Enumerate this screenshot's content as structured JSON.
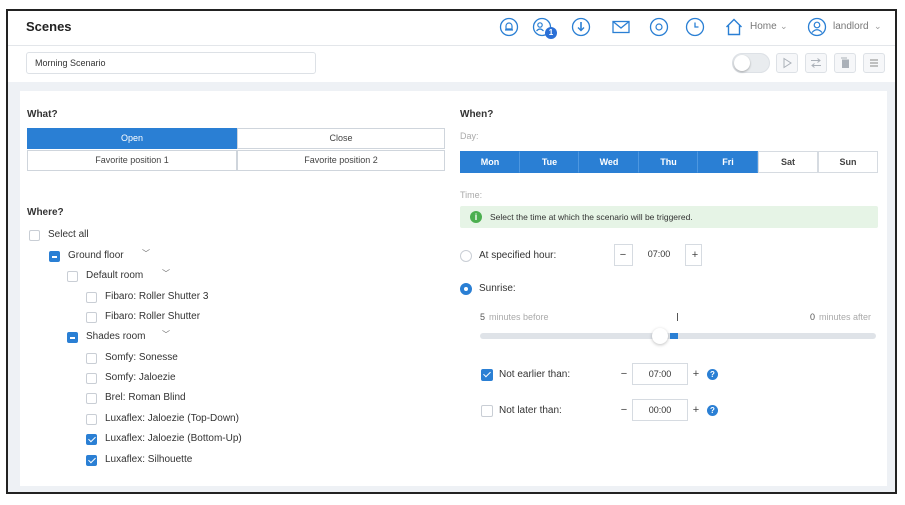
{
  "header": {
    "title": "Scenes",
    "badge_count": "1",
    "home_label": "Home",
    "user_label": "landlord"
  },
  "scenario": {
    "name": "Morning Scenario",
    "enabled": false
  },
  "what": {
    "heading": "What?",
    "options": [
      {
        "label": "Open",
        "active": true
      },
      {
        "label": "Close",
        "active": false
      },
      {
        "label": "Favorite position 1",
        "active": false
      },
      {
        "label": "Favorite position 2",
        "active": false
      }
    ]
  },
  "where": {
    "heading": "Where?",
    "select_all": "Select all",
    "ground_floor": "Ground floor",
    "default_room": "Default room",
    "default_devices": [
      "Fibaro: Roller Shutter 3",
      "Fibaro: Roller Shutter"
    ],
    "shades_room": "Shades room",
    "shades_devices": [
      {
        "label": "Somfy: Sonesse",
        "checked": false
      },
      {
        "label": "Somfy: Jaloezie",
        "checked": false
      },
      {
        "label": "Brel: Roman Blind",
        "checked": false
      },
      {
        "label": "Luxaflex: Jaloezie (Top-Down)",
        "checked": false
      },
      {
        "label": "Luxaflex: Jaloezie (Bottom-Up)",
        "checked": true
      },
      {
        "label": "Luxaflex: Silhouette",
        "checked": true
      }
    ]
  },
  "when": {
    "heading": "When?",
    "day_label": "Day:",
    "days": [
      {
        "label": "Mon",
        "selected": true
      },
      {
        "label": "Tue",
        "selected": true
      },
      {
        "label": "Wed",
        "selected": true
      },
      {
        "label": "Thu",
        "selected": true
      },
      {
        "label": "Fri",
        "selected": true
      },
      {
        "label": "Sat",
        "selected": false
      },
      {
        "label": "Sun",
        "selected": false
      }
    ],
    "time_label": "Time:",
    "info_icon_text": "i",
    "info_text": "Select the time at which the scenario will be triggered.",
    "at_hour_label": "At specified hour:",
    "at_hour_value": "07:00",
    "sunrise_label": "Sunrise:",
    "minutes_before_value": "5",
    "minutes_before_label": "minutes before",
    "minutes_after_value": "0",
    "minutes_after_label": "minutes after",
    "slider_value_before": 5,
    "slider_value_after": 0,
    "not_earlier_label": "Not earlier than:",
    "not_earlier_value": "07:00",
    "not_later_label": "Not later than:",
    "not_later_value": "00:00",
    "minus": "−",
    "plus": "+",
    "help": "?"
  },
  "colors": {
    "accent": "#2a7fd4",
    "info_bg": "#e6f4e6",
    "info_icon": "#4caf50"
  },
  "icons": [
    "alarm-icon",
    "users-icon",
    "download-icon",
    "mail-icon",
    "settings-icon",
    "clock-icon",
    "home-icon",
    "user-icon",
    "play-icon",
    "transfer-icon",
    "copy-icon",
    "menu-icon"
  ]
}
